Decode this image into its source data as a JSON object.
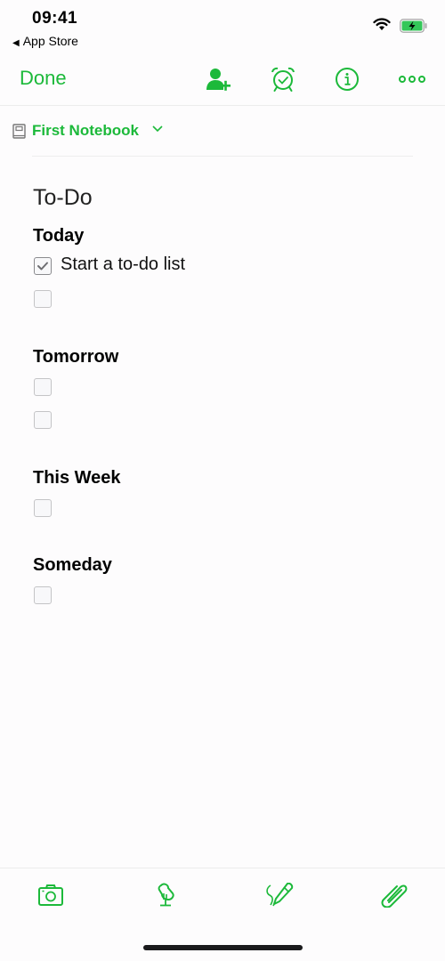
{
  "status_bar": {
    "time": "09:41",
    "back_app": "App Store",
    "back_arrow": "◀"
  },
  "toolbar": {
    "done_label": "Done",
    "icons": [
      "share-user-icon",
      "reminder-alarm-icon",
      "info-icon",
      "more-icon"
    ]
  },
  "notebook": {
    "label": "First Notebook"
  },
  "note": {
    "title": "To-Do",
    "sections": [
      {
        "heading": "Today",
        "items": [
          {
            "text": "Start a to-do list",
            "checked": true
          },
          {
            "text": "",
            "checked": false
          }
        ]
      },
      {
        "heading": "Tomorrow",
        "items": [
          {
            "text": "",
            "checked": false
          },
          {
            "text": "",
            "checked": false
          }
        ]
      },
      {
        "heading": "This Week",
        "items": [
          {
            "text": "",
            "checked": false
          }
        ]
      },
      {
        "heading": "Someday",
        "items": [
          {
            "text": "",
            "checked": false
          }
        ]
      }
    ]
  },
  "bottom_bar": {
    "icons": [
      "camera-icon",
      "microphone-icon",
      "sketch-pen-icon",
      "attachment-icon"
    ]
  },
  "colors": {
    "accent": "#1cb93a",
    "text": "#000000",
    "checkbox_border": "#c4c4c6"
  }
}
